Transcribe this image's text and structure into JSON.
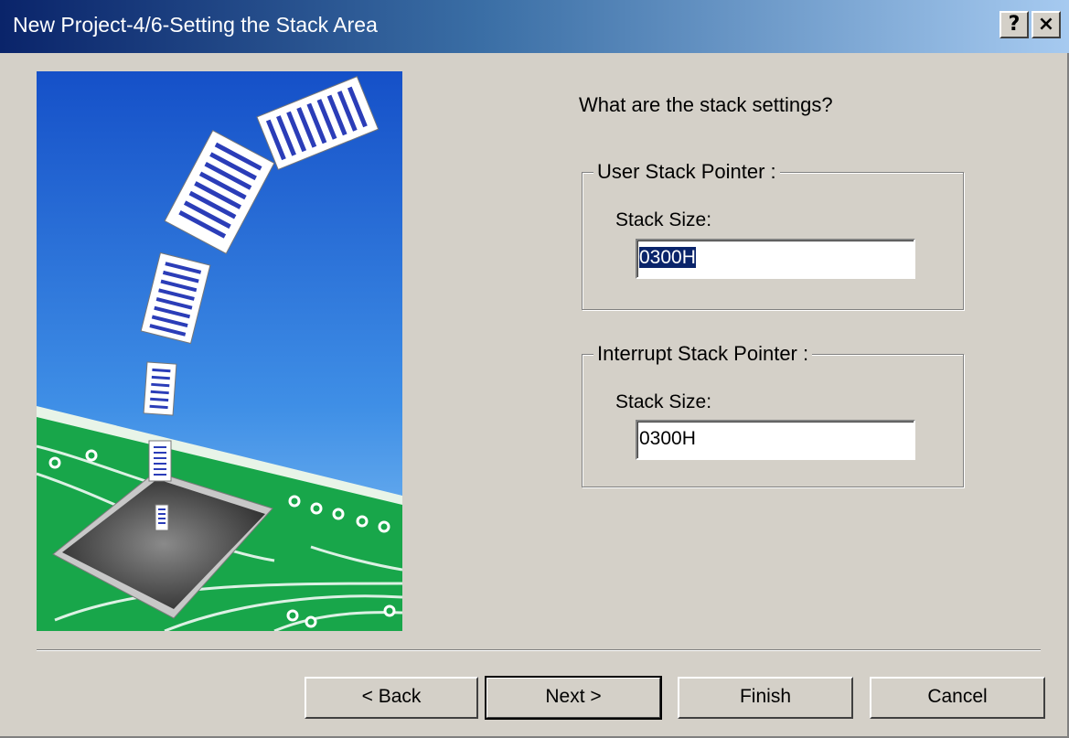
{
  "window": {
    "title": "New Project-4/6-Setting the Stack Area",
    "help_label": "?",
    "close_label": "×"
  },
  "main": {
    "question": "What are the stack settings?",
    "user_stack": {
      "legend": "User Stack Pointer :",
      "label": "Stack Size:",
      "value": "0300H"
    },
    "interrupt_stack": {
      "legend": "Interrupt Stack Pointer :",
      "label": "Stack Size:",
      "value": "0300H"
    }
  },
  "buttons": {
    "back": "< Back",
    "next": "Next >",
    "finish": "Finish",
    "cancel": "Cancel"
  },
  "colors": {
    "face": "#d4d0c8",
    "title_start": "#0a246a",
    "title_end": "#a6caf0",
    "sky_top": "#1f5fd0",
    "board": "#1aa84a"
  },
  "icons": [
    "help-icon",
    "close-icon"
  ]
}
